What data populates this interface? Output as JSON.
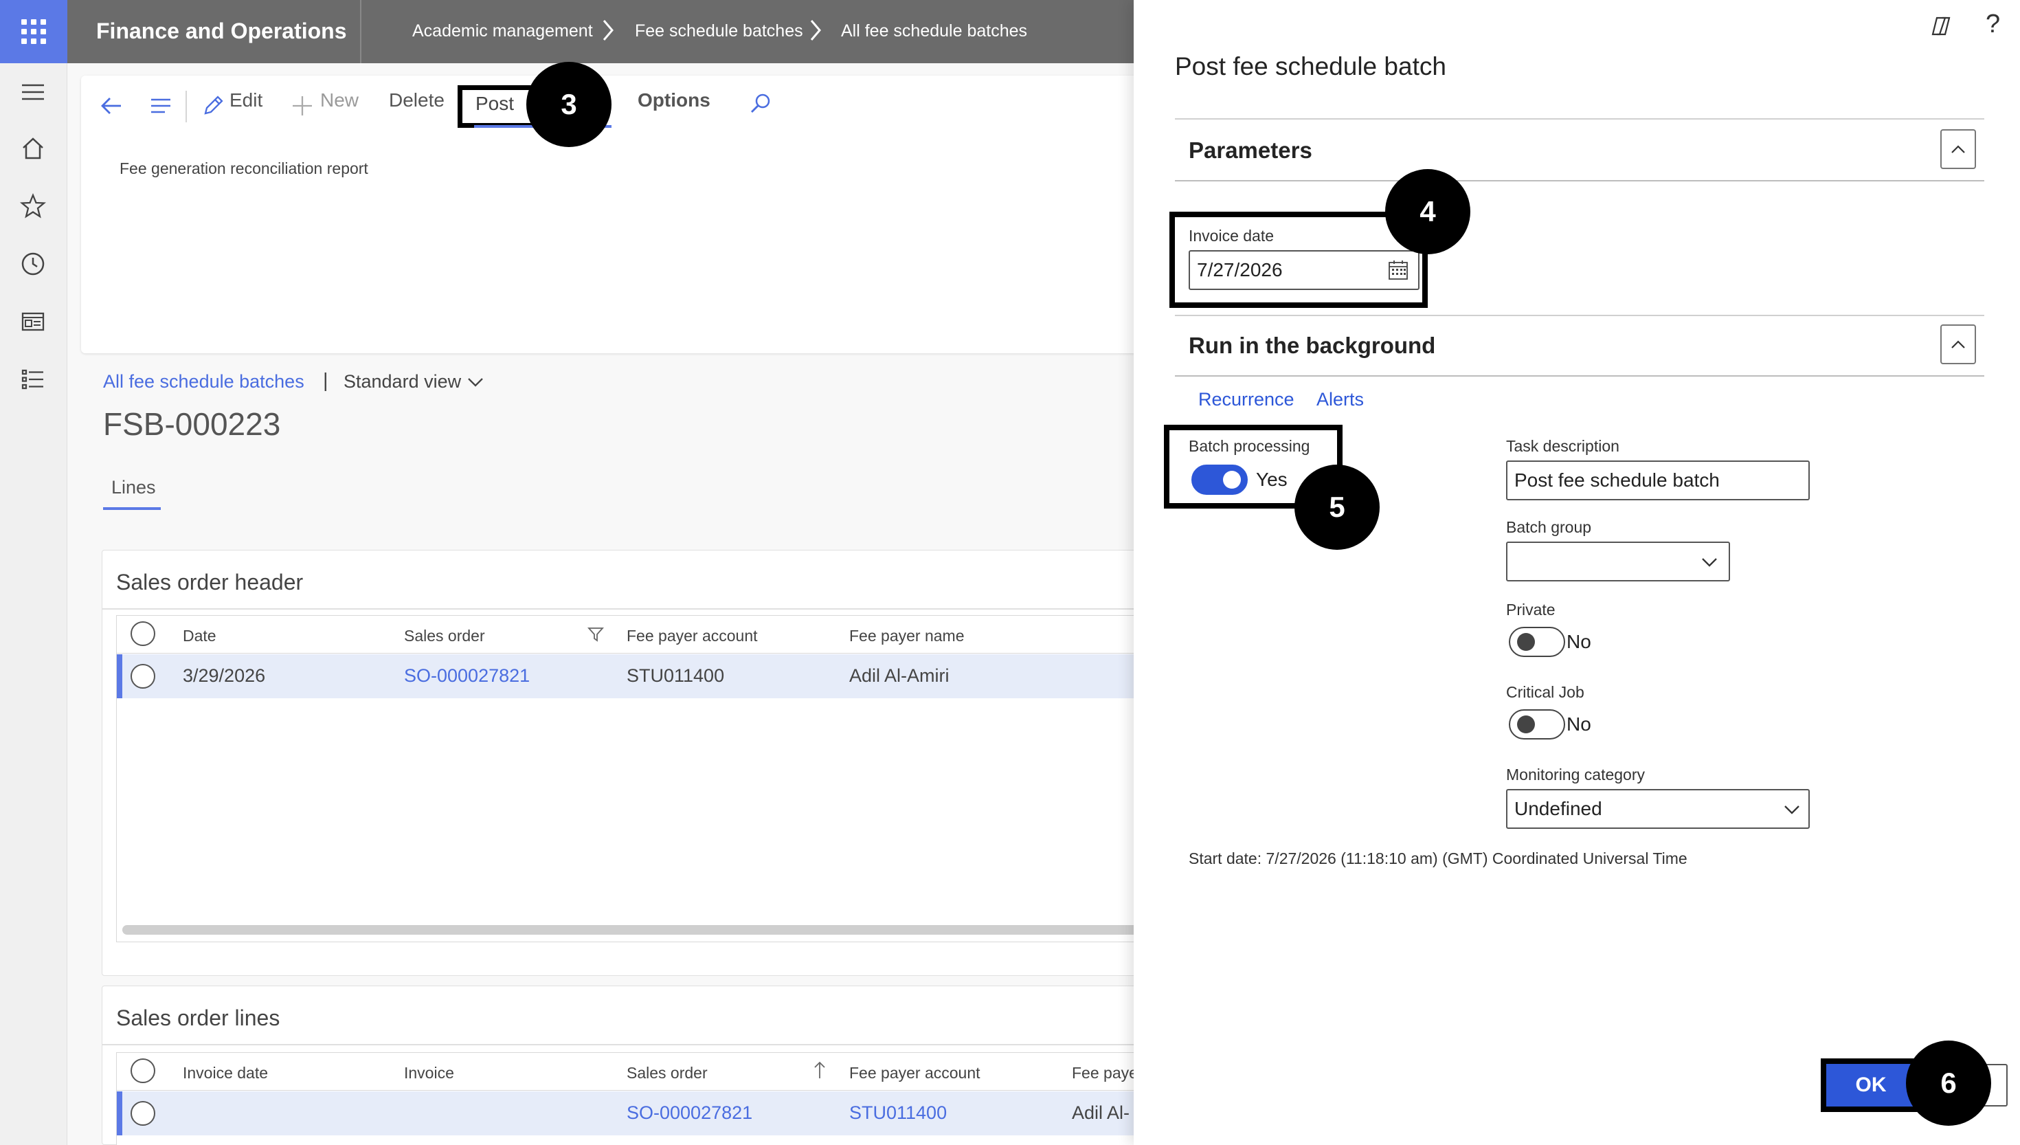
{
  "topbar": {
    "app_title": "Finance and Operations",
    "breadcrumb": [
      "Academic management",
      "Fee schedule batches",
      "All fee schedule batches"
    ]
  },
  "actionbar": {
    "edit": "Edit",
    "new": "New",
    "delete": "Delete",
    "post": "Post",
    "options": "Options",
    "fee_report": "Fee generation reconciliation report"
  },
  "page": {
    "breadcrumb_link": "All fee schedule batches",
    "separator": "|",
    "view": "Standard view",
    "record_id": "FSB-000223",
    "tab": "Lines"
  },
  "header_grid": {
    "title": "Sales order header",
    "columns": [
      "Date",
      "Sales order",
      "Fee payer account",
      "Fee payer name"
    ],
    "rows": [
      {
        "date": "3/29/2026",
        "sales_order": "SO-000027821",
        "fee_payer_account": "STU011400",
        "fee_payer_name": "Adil Al-Amiri"
      }
    ]
  },
  "lines_grid": {
    "title": "Sales order lines",
    "columns": [
      "Invoice date",
      "Invoice",
      "Sales order",
      "Fee payer account",
      "Fee paye"
    ],
    "rows": [
      {
        "invoice_date": "",
        "invoice": "",
        "sales_order": "SO-000027821",
        "fee_payer_account": "STU011400",
        "fee_payer_name": "Adil Al-"
      }
    ]
  },
  "panel": {
    "title": "Post fee schedule batch",
    "help": "?",
    "parameters": {
      "heading": "Parameters",
      "invoice_date_label": "Invoice date",
      "invoice_date_value": "7/27/2026"
    },
    "background": {
      "heading": "Run in the background",
      "tabs": [
        "Recurrence",
        "Alerts"
      ],
      "batch_processing_label": "Batch processing",
      "batch_processing_value": "Yes",
      "batch_processing_on": true,
      "task_description_label": "Task description",
      "task_description_value": "Post fee schedule batch",
      "batch_group_label": "Batch group",
      "batch_group_value": "",
      "private_label": "Private",
      "private_value": "No",
      "critical_job_label": "Critical Job",
      "critical_job_value": "No",
      "monitoring_category_label": "Monitoring category",
      "monitoring_category_value": "Undefined",
      "start_date": "Start date: 7/27/2026 (11:18:10 am) (GMT) Coordinated Universal Time"
    },
    "ok_label": "OK"
  },
  "step_badges": [
    "3",
    "4",
    "5",
    "6"
  ],
  "colors": {
    "accent": "#5b79e6",
    "link": "#4a6de0",
    "toggle_on": "#2d57d8",
    "topbar": "#6b6b6b",
    "highlight_box": "#000000"
  }
}
